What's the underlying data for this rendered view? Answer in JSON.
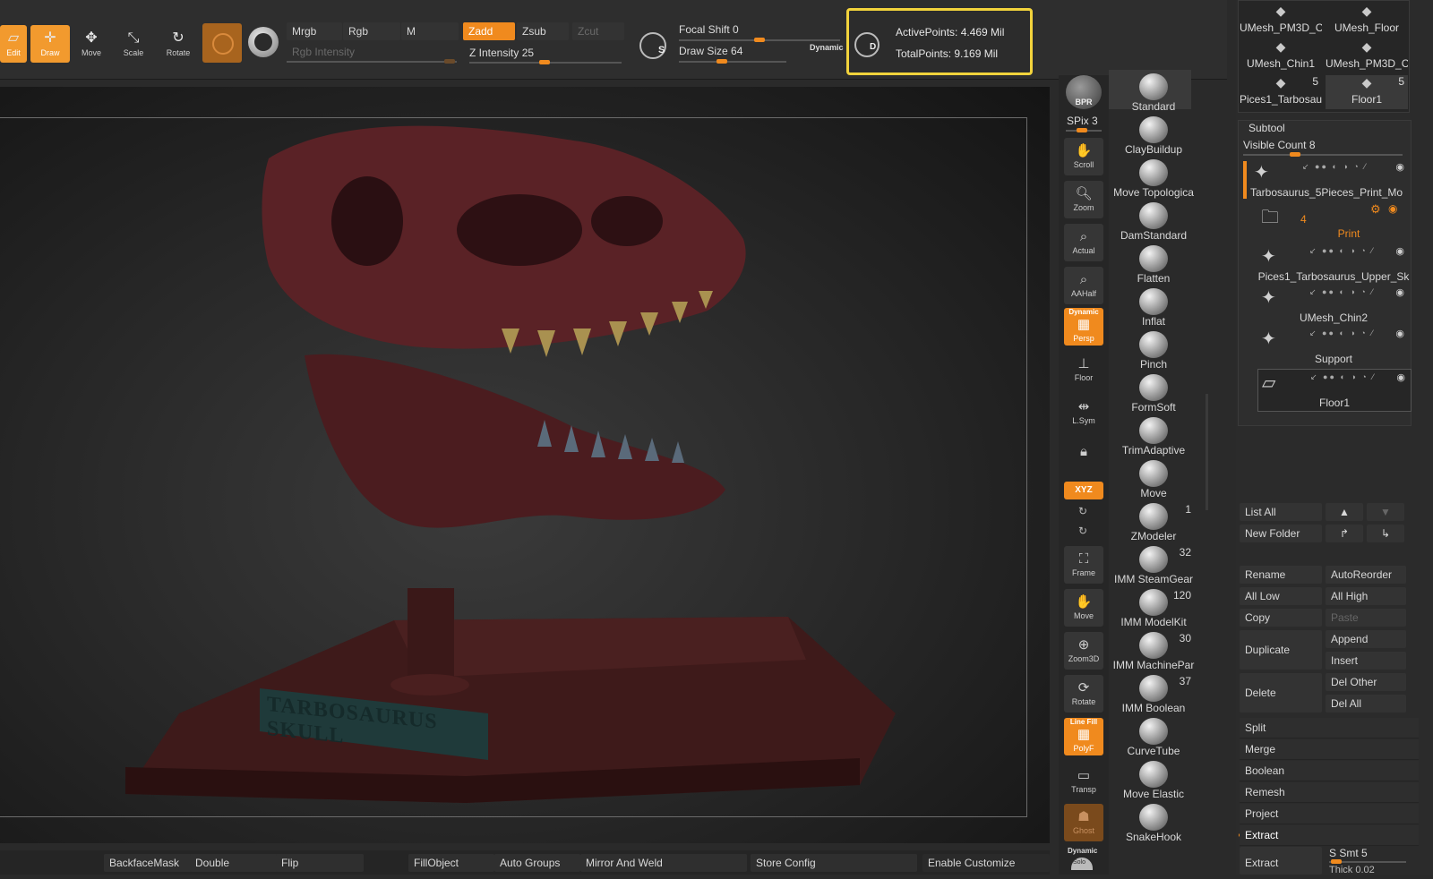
{
  "toolbar": {
    "buttons": [
      {
        "label": "Edit",
        "icon": "edit-icon",
        "active": true
      },
      {
        "label": "Draw",
        "icon": "draw-icon",
        "active": true
      },
      {
        "label": "Move",
        "icon": "move-icon",
        "active": false
      },
      {
        "label": "Scale",
        "icon": "scale-icon",
        "active": false
      },
      {
        "label": "Rotate",
        "icon": "rotate-icon",
        "active": false
      }
    ],
    "mrgb": "Mrgb",
    "rgb": "Rgb",
    "m": "M",
    "zadd": "Zadd",
    "zsub": "Zsub",
    "zcut": "Zcut",
    "rgb_intensity": "Rgb Intensity",
    "z_intensity_label": "Z Intensity",
    "z_intensity_value": "25",
    "focal_shift_label": "Focal Shift",
    "focal_shift_value": "0",
    "draw_size_label": "Draw Size",
    "draw_size_value": "64",
    "dynamic": "Dynamic",
    "active_points": "ActivePoints: 4.469 Mil",
    "total_points": "TotalPoints: 9.169 Mil"
  },
  "viewport": {
    "plaque_text": "TARBOSAURUS SKULL"
  },
  "bottombar": {
    "buttons": [
      "BackfaceMask",
      "Double",
      "Flip",
      "FillObject",
      "Auto Groups",
      "Mirror And Weld",
      "Store Config",
      "Enable Customize"
    ]
  },
  "shelf": {
    "bpr": "BPR",
    "spix": "SPix 3",
    "scroll": "Scroll",
    "zoom": "Zoom",
    "actual": "Actual",
    "aahalf": "AAHalf",
    "persp_dynamic": "Dynamic",
    "persp": "Persp",
    "floor": "Floor",
    "lsym": "L.Sym",
    "xyz": "XYZ",
    "frame": "Frame",
    "move": "Move",
    "zoom3d": "Zoom3D",
    "rotate": "Rotate",
    "linefill": "Line Fill",
    "polyf": "PolyF",
    "transp": "Transp",
    "ghost": "Ghost",
    "solo_dynamic": "Dynamic",
    "solo": "Solo"
  },
  "brushes": [
    {
      "name": "Standard",
      "count": ""
    },
    {
      "name": "ClayBuildup",
      "count": ""
    },
    {
      "name": "Move Topologica",
      "count": ""
    },
    {
      "name": "DamStandard",
      "count": ""
    },
    {
      "name": "Flatten",
      "count": ""
    },
    {
      "name": "Inflat",
      "count": ""
    },
    {
      "name": "Pinch",
      "count": ""
    },
    {
      "name": "FormSoft",
      "count": ""
    },
    {
      "name": "TrimAdaptive",
      "count": ""
    },
    {
      "name": "Move",
      "count": ""
    },
    {
      "name": "ZModeler",
      "count": "1"
    },
    {
      "name": "IMM SteamGear",
      "count": "32"
    },
    {
      "name": "IMM ModelKit",
      "count": "120"
    },
    {
      "name": "IMM MachinePar",
      "count": "30"
    },
    {
      "name": "IMM Boolean",
      "count": "37"
    },
    {
      "name": "CurveTube",
      "count": ""
    },
    {
      "name": "Move Elastic",
      "count": ""
    },
    {
      "name": "SnakeHook",
      "count": ""
    }
  ],
  "tool_thumbs": [
    {
      "name": "UMesh_PM3D_C",
      "count": ""
    },
    {
      "name": "UMesh_Floor",
      "count": ""
    },
    {
      "name": "UMesh_Chin1",
      "count": ""
    },
    {
      "name": "UMesh_PM3D_C",
      "count": ""
    },
    {
      "name": "Pices1_Tarbosau",
      "count": "5"
    },
    {
      "name": "Floor1",
      "count": "5"
    }
  ],
  "subtool": {
    "title": "Subtool",
    "visible_count": "Visible Count 8",
    "items": [
      {
        "name": "Tarbosaurus_5Pieces_Print_Mo"
      },
      {
        "name": "Print",
        "folder_count": "4"
      },
      {
        "name": "Pices1_Tarbosaurus_Upper_Sk"
      },
      {
        "name": "UMesh_Chin2"
      },
      {
        "name": "Support"
      },
      {
        "name": "Floor1"
      }
    ],
    "list_all": "List All",
    "new_folder": "New Folder",
    "rename": "Rename",
    "autoreorder": "AutoReorder",
    "all_low": "All Low",
    "all_high": "All High",
    "copy": "Copy",
    "paste": "Paste",
    "duplicate": "Duplicate",
    "append": "Append",
    "insert": "Insert",
    "delete": "Delete",
    "del_other": "Del Other",
    "del_all": "Del All",
    "split": "Split",
    "merge": "Merge",
    "boolean": "Boolean",
    "remesh": "Remesh",
    "project": "Project",
    "extract": "Extract",
    "extract_btn": "Extract",
    "s_smt": "S Smt 5",
    "thick": "Thick 0.02"
  },
  "colors": {
    "accent": "#f08a1e",
    "highlight_box": "#f2d33c"
  }
}
